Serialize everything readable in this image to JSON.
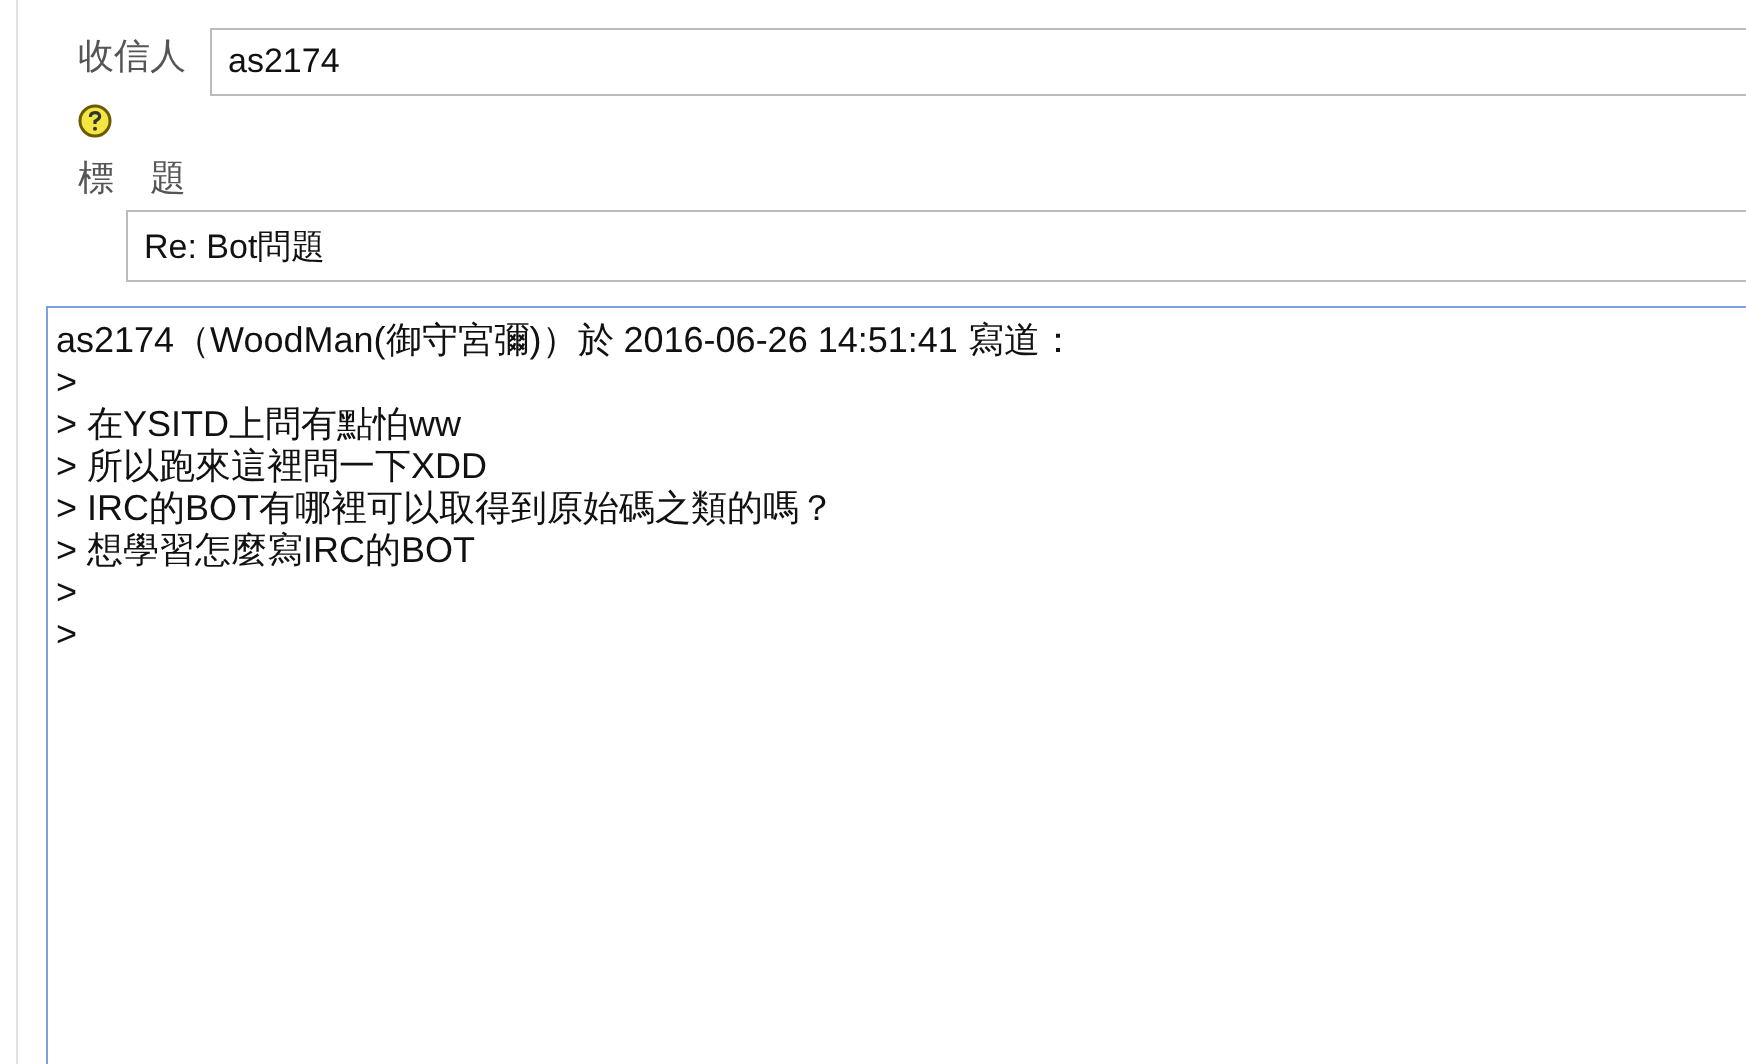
{
  "recipient": {
    "label": "收信人",
    "value": "as2174"
  },
  "subject": {
    "label": "標　題",
    "value": "Re: Bot問題"
  },
  "message": {
    "lines": [
      "as2174（WoodMan(御守宮彌)）於 2016-06-26 14:51:41 寫道：",
      ">",
      "> 在YSITD上問有點怕ww",
      "> 所以跑來這裡問一下XDD",
      "> IRC的BOT有哪裡可以取得到原始碼之類的嗎？",
      "> 想學習怎麼寫IRC的BOT",
      ">",
      "> "
    ]
  }
}
